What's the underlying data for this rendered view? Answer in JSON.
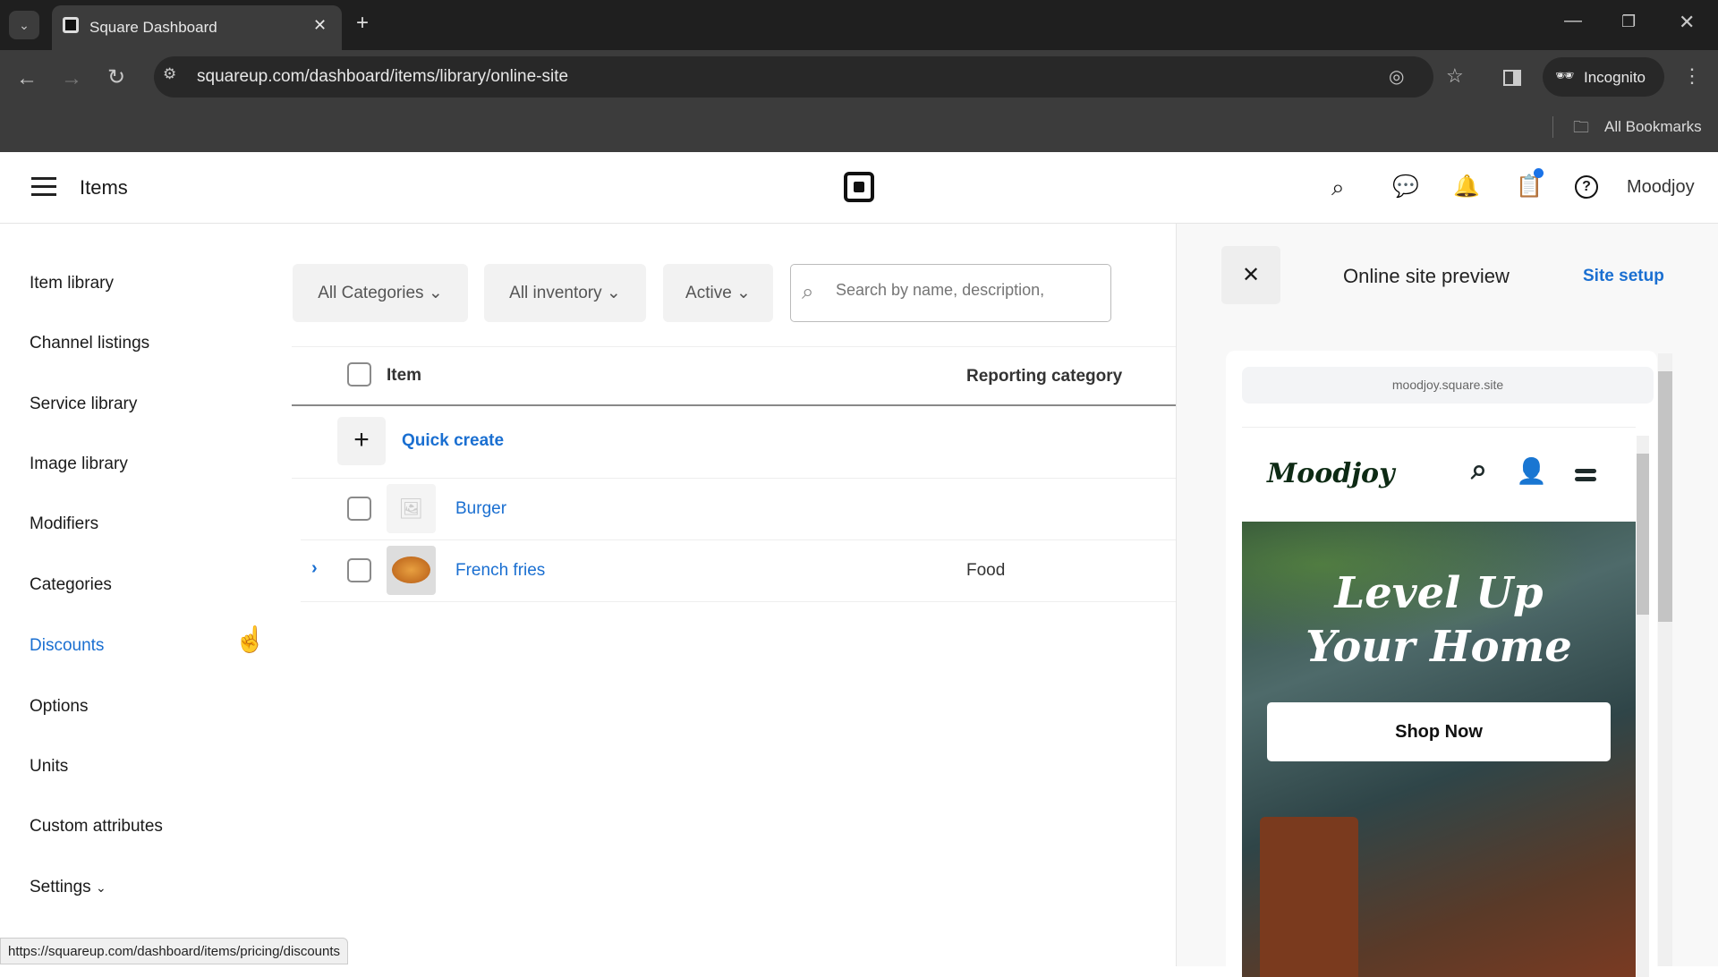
{
  "browser": {
    "tab_title": "Square Dashboard",
    "url": "squareup.com/dashboard/items/library/online-site",
    "incognito_label": "Incognito",
    "bookmarks_label": "All Bookmarks",
    "status_url": "https://squareup.com/dashboard/items/pricing/discounts"
  },
  "header": {
    "title": "Items",
    "account": "Moodjoy"
  },
  "sidebar": {
    "items": [
      {
        "label": "Item library"
      },
      {
        "label": "Channel listings"
      },
      {
        "label": "Service library"
      },
      {
        "label": "Image library"
      },
      {
        "label": "Modifiers"
      },
      {
        "label": "Categories"
      },
      {
        "label": "Discounts",
        "active": true
      },
      {
        "label": "Options"
      },
      {
        "label": "Units"
      },
      {
        "label": "Custom attributes"
      },
      {
        "label": "Settings"
      }
    ]
  },
  "filters": {
    "categories": "All Categories",
    "inventory": "All inventory",
    "status": "Active",
    "search_placeholder": "Search by name, description,"
  },
  "table": {
    "columns": [
      "Item",
      "Reporting category"
    ],
    "quick_create": "Quick create",
    "rows": [
      {
        "name": "Burger",
        "category": ""
      },
      {
        "name": "French fries",
        "category": "Food"
      }
    ]
  },
  "preview": {
    "title": "Online site preview",
    "setup_link": "Site setup",
    "site_url": "moodjoy.square.site",
    "brand": "Moodjoy",
    "hero_line1": "Level Up",
    "hero_line2": "Your Home",
    "cta": "Shop Now"
  },
  "colors": {
    "accent": "#1a6fd1",
    "notification": "#1a73e8"
  }
}
